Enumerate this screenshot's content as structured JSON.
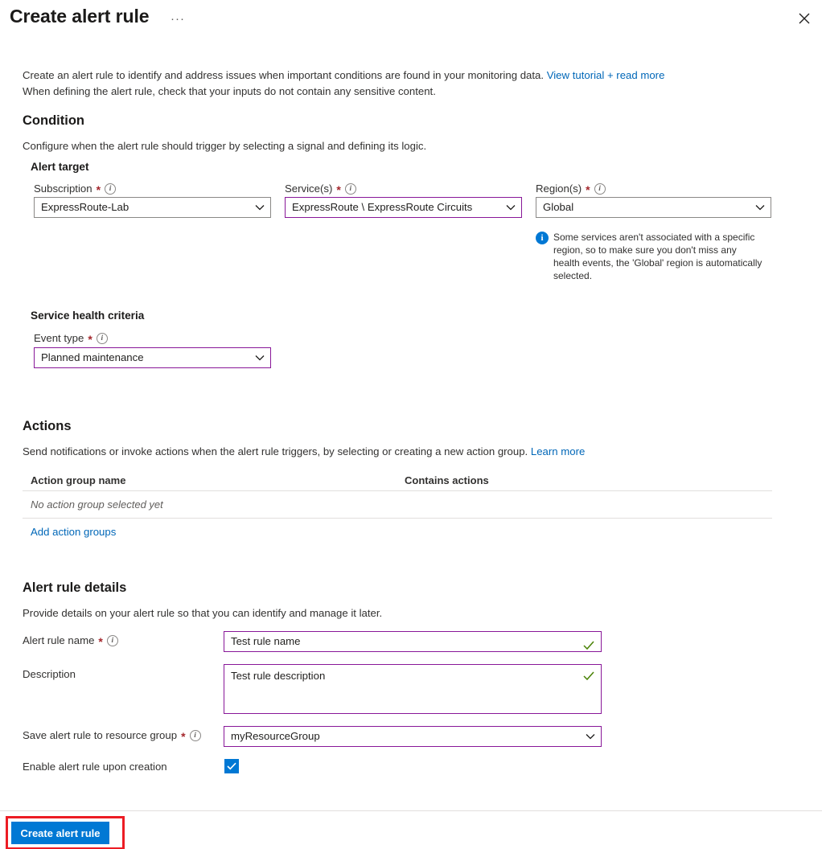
{
  "header": {
    "title": "Create alert rule",
    "ellipsis_label": "···",
    "close_label": "Close"
  },
  "intro": {
    "line1": "Create an alert rule to identify and address issues when important conditions are found in your monitoring data. ",
    "link": "View tutorial + read more",
    "line2": "When defining the alert rule, check that your inputs do not contain any sensitive content."
  },
  "condition": {
    "heading": "Condition",
    "subtext": "Configure when the alert rule should trigger by selecting a signal and defining its logic.",
    "alert_target_heading": "Alert target",
    "subscription": {
      "label": "Subscription",
      "required": "*",
      "value": "ExpressRoute-Lab"
    },
    "services": {
      "label": "Service(s)",
      "required": "*",
      "value": "ExpressRoute \\ ExpressRoute Circuits"
    },
    "regions": {
      "label": "Region(s)",
      "required": "*",
      "value": "Global"
    },
    "region_note": "Some services aren't associated with a specific region, so to make sure you don't miss any health events, the 'Global' region is automatically selected.",
    "criteria_heading": "Service health criteria",
    "event_type": {
      "label": "Event type",
      "required": "*",
      "value": "Planned maintenance"
    }
  },
  "actions": {
    "heading": "Actions",
    "subtext": "Send notifications or invoke actions when the alert rule triggers, by selecting or creating a new action group. ",
    "learn_more": "Learn more",
    "table": {
      "columns": [
        "Action group name",
        "Contains actions"
      ],
      "empty_text": "No action group selected yet"
    },
    "add_link": "Add action groups"
  },
  "details": {
    "heading": "Alert rule details",
    "subtext": "Provide details on your alert rule so that you can identify and manage it later.",
    "rule_name": {
      "label": "Alert rule name",
      "required": "*",
      "value": "Test rule name"
    },
    "description": {
      "label": "Description",
      "value": "Test rule description"
    },
    "resource_group": {
      "label": "Save alert rule to resource group",
      "required": "*",
      "value": "myResourceGroup"
    },
    "enable": {
      "label": "Enable alert rule upon creation",
      "checked": true
    }
  },
  "footer": {
    "create_button": "Create alert rule"
  },
  "colors": {
    "accent_blue": "#0078d4",
    "link_blue": "#0067b8",
    "valid_purple": "#881798",
    "required_red": "#a4262c",
    "highlight_red": "#ec1c24",
    "check_green": "#498205"
  }
}
